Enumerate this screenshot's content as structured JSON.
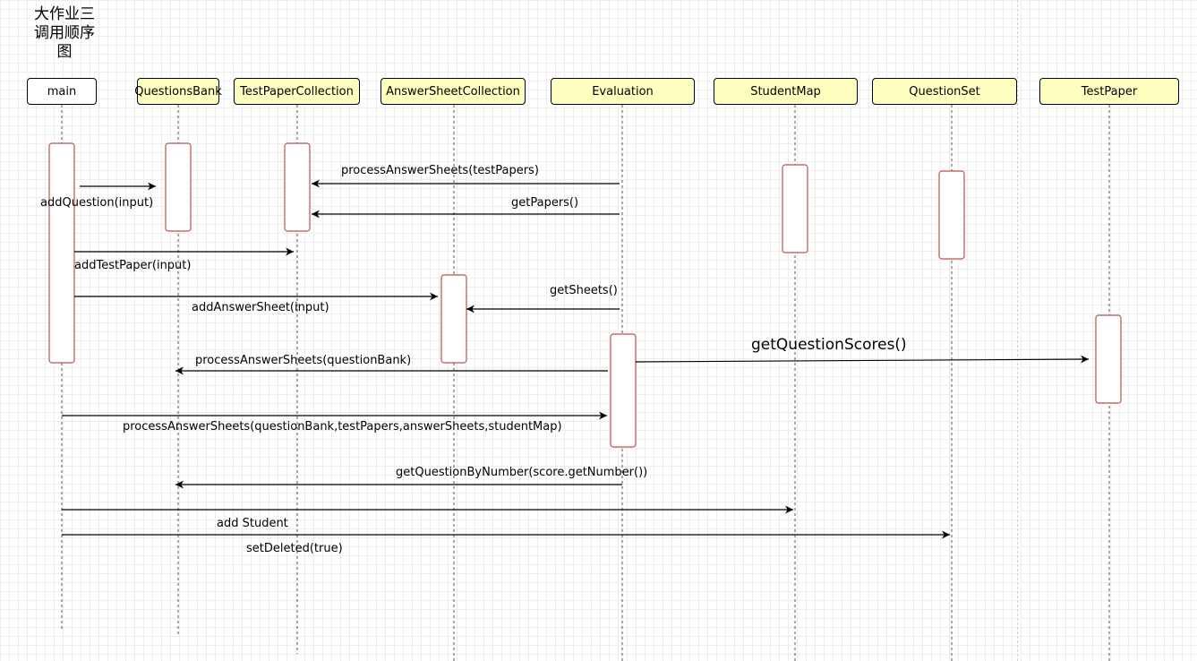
{
  "diagram": {
    "title": "大作业三\n调用顺序\n图",
    "participants": {
      "main": "main",
      "questions_bank": "QuestionsBank",
      "test_paper_collection": "TestPaperCollection",
      "answer_sheet_collection": "AnswerSheetCollection",
      "evaluation": "Evaluation",
      "student_map": "StudentMap",
      "question_set": "QuestionSet",
      "test_paper": "TestPaper"
    },
    "messages": {
      "add_question": "addQuestion(input)",
      "add_test_paper": "addTestPaper(input)",
      "add_answer_sheet": "addAnswerSheet(input)",
      "process_answer_sheets_test_papers": "processAnswerSheets(testPapers)",
      "get_papers": "getPapers()",
      "get_sheets": "getSheets()",
      "get_question_scores": "getQuestionScores()",
      "process_answer_sheets_question_bank": "processAnswerSheets(questionBank)",
      "process_answer_sheets_full": "processAnswerSheets(questionBank,testPapers,answerSheets,studentMap)",
      "get_question_by_number": "getQuestionByNumber(score.getNumber())",
      "add_student": "add Student",
      "set_deleted": "setDeleted(true)"
    },
    "colors": {
      "participant_fill": "#ffffc0",
      "main_fill": "#ffffff",
      "activation_border": "#b85450",
      "line": "#000000"
    }
  }
}
